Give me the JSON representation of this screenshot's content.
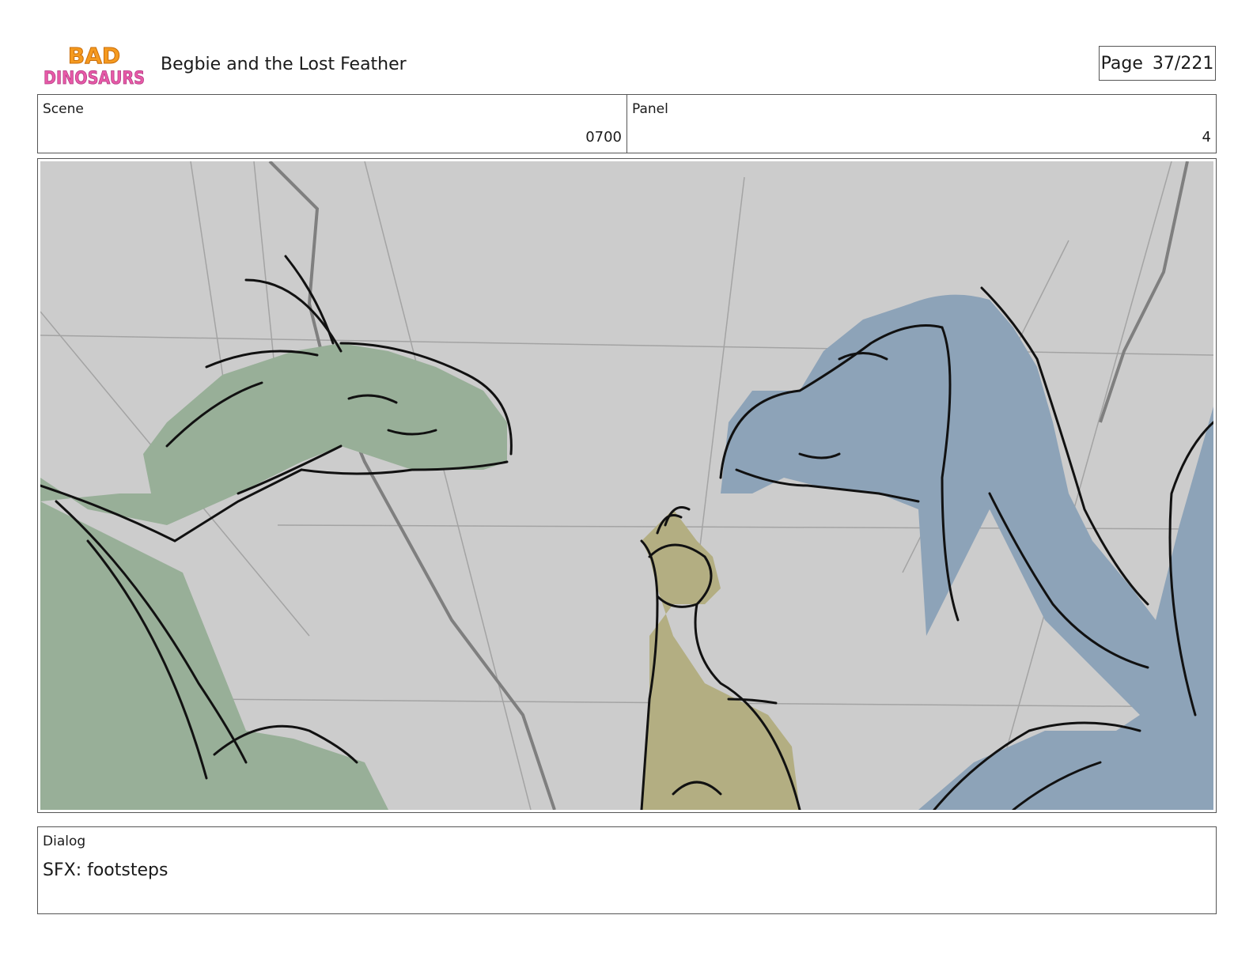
{
  "header": {
    "logo_text_line1": "BAD",
    "logo_text_line2": "DINOSAURS",
    "title": "Begbie and the Lost Feather",
    "page_label": "Page",
    "page_number": "37/221"
  },
  "info": {
    "scene_label": "Scene",
    "scene_value": "0700",
    "panel_label": "Panel",
    "panel_value": "4"
  },
  "panel_image": {
    "background_color": "#cccccc",
    "characters": [
      {
        "name": "green-dinosaur",
        "color": "#98af98"
      },
      {
        "name": "small-tan-dinosaur",
        "color": "#b3ae82"
      },
      {
        "name": "blue-dinosaur",
        "color": "#8da3b8"
      }
    ]
  },
  "dialog": {
    "label": "Dialog",
    "text": "SFX: footsteps"
  }
}
